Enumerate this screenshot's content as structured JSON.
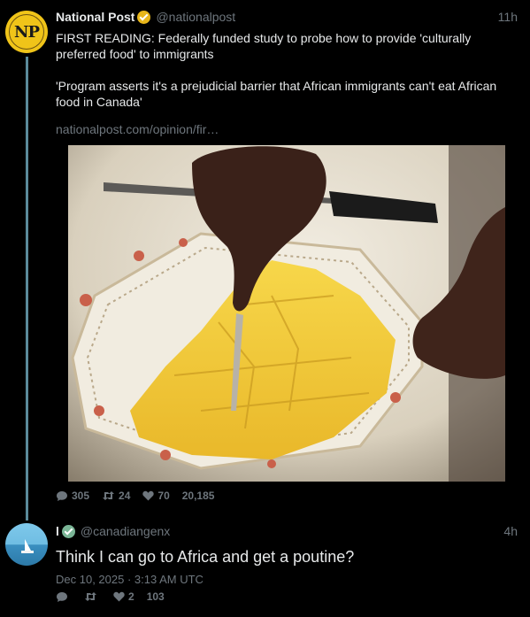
{
  "post": {
    "author_name": "National Post",
    "handle": "@nationalpost",
    "time": "11h",
    "text": "FIRST READING: Federally funded study to probe how to provide 'culturally preferred food' to immigrants\n\n'Program asserts it's a prejudicial barrier that African immigrants can't eat African food in Canada'",
    "link": "nationalpost.com/opinion/fir…",
    "replies": "305",
    "retweets": "24",
    "likes": "70",
    "views": "20,185",
    "avatar_text": "NP"
  },
  "reply": {
    "author_name": "l",
    "handle": "@canadiangenx",
    "time": "4h",
    "text": "Think I can go to Africa and get a poutine?",
    "date": "Dec 10, 2025 · 3:13 AM UTC",
    "replies": "",
    "retweets": "",
    "likes": "2",
    "views": "103"
  },
  "colors": {
    "background": "#000000",
    "text": "#e7e9ea",
    "muted": "#6e767d",
    "thread_line": "#5a8a9a",
    "gold_badge": "#e8b61a"
  }
}
